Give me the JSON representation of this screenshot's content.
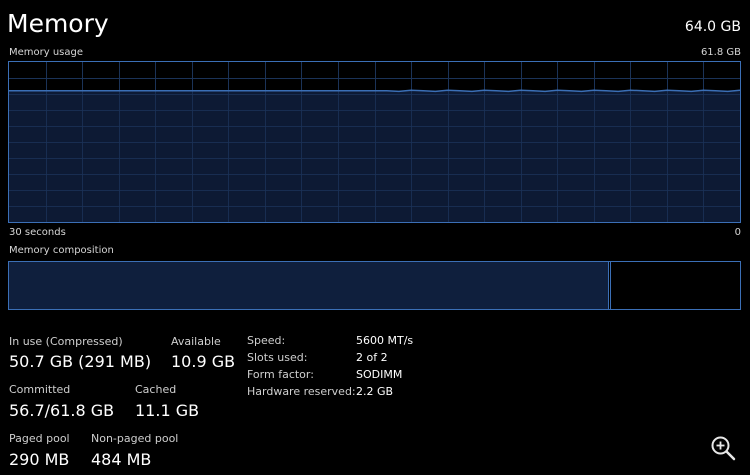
{
  "header": {
    "title": "Memory",
    "total": "64.0 GB"
  },
  "usage": {
    "label": "Memory usage",
    "max_label": "61.8 GB",
    "time_left": "30 seconds",
    "time_right": "0",
    "fill_fraction": 0.82,
    "line_color": "#3b6fb6",
    "fill_color": "#0f1f3d",
    "grid_color": "#1b3358"
  },
  "composition": {
    "label": "Memory composition",
    "in_use_fraction": 0.82
  },
  "stats": {
    "in_use_label": "In use (Compressed)",
    "in_use_value": "50.7 GB (291 MB)",
    "available_label": "Available",
    "available_value": "10.9 GB",
    "committed_label": "Committed",
    "committed_value": "56.7/61.8 GB",
    "cached_label": "Cached",
    "cached_value": "11.1 GB",
    "paged_label": "Paged pool",
    "paged_value": "290 MB",
    "nonpaged_label": "Non-paged pool",
    "nonpaged_value": "484 MB"
  },
  "specs": [
    {
      "label": "Speed:",
      "value": "5600 MT/s"
    },
    {
      "label": "Slots used:",
      "value": "2 of 2"
    },
    {
      "label": "Form factor:",
      "value": "SODIMM"
    },
    {
      "label": "Hardware reserved:",
      "value": "2.2 GB"
    }
  ],
  "icons": {
    "zoom": "zoom-in-icon"
  }
}
